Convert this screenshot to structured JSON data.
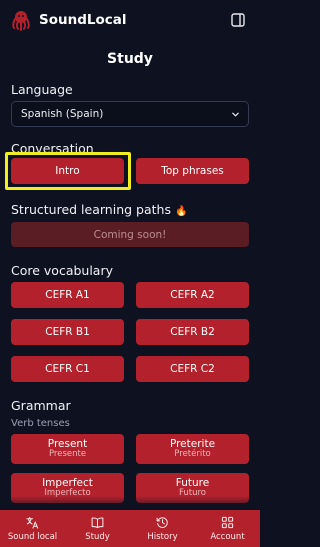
{
  "app": {
    "name": "SoundLocal"
  },
  "page": {
    "title": "Study"
  },
  "language": {
    "label": "Language",
    "selected": "Spanish (Spain)"
  },
  "conversation": {
    "label": "Conversation",
    "intro_label": "Intro",
    "top_phrases_label": "Top phrases"
  },
  "learning_paths": {
    "label": "Structured learning paths",
    "emoji": "🔥",
    "coming_soon_label": "Coming soon!"
  },
  "core_vocabulary": {
    "label": "Core vocabulary",
    "levels": [
      "CEFR A1",
      "CEFR A2",
      "CEFR B1",
      "CEFR B2",
      "CEFR C1",
      "CEFR C2"
    ]
  },
  "grammar": {
    "label": "Grammar",
    "verb_tenses_label": "Verb tenses",
    "tenses": [
      {
        "name": "Present",
        "native": "Presente"
      },
      {
        "name": "Preterite",
        "native": "Pretérito"
      },
      {
        "name": "Imperfect",
        "native": "Imperfecto"
      },
      {
        "name": "Future",
        "native": "Futuro"
      }
    ]
  },
  "bottom_nav": [
    {
      "label": "Sound local",
      "icon": "translate-icon"
    },
    {
      "label": "Study",
      "icon": "book-icon"
    },
    {
      "label": "History",
      "icon": "history-icon"
    },
    {
      "label": "Account",
      "icon": "grid-icon"
    }
  ],
  "colors": {
    "background": "#0e1120",
    "accent": "#b3222c",
    "disabled": "#5a1d23",
    "highlight": "#f1ee1f"
  }
}
